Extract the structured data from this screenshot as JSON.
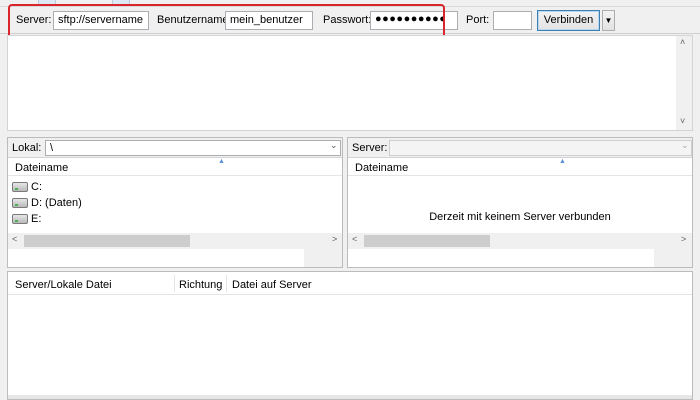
{
  "quickconnect": {
    "server_label": "Server:",
    "server_value": "sftp://servername",
    "user_label": "Benutzername:",
    "user_value": "mein_benutzer",
    "password_label": "Passwort:",
    "password_value": "●●●●●●●●●●",
    "port_label": "Port:",
    "port_value": "",
    "connect_label": "Verbinden",
    "highlight_color": "#d9252b"
  },
  "local_pane": {
    "path_label": "Lokal:",
    "path_value": "\\",
    "column_header": "Dateiname",
    "drives": [
      {
        "name": "C:",
        "icon": "hard-drive-icon"
      },
      {
        "name": "D: (Daten)",
        "icon": "hard-drive-icon"
      },
      {
        "name": "E:",
        "icon": "removable-drive-icon"
      }
    ]
  },
  "remote_pane": {
    "path_label": "Server:",
    "path_value": "",
    "column_header": "Dateiname",
    "empty_message": "Derzeit mit keinem Server verbunden"
  },
  "queue": {
    "columns": [
      "Server/Lokale Datei",
      "Richtung",
      "Datei auf Server"
    ]
  }
}
